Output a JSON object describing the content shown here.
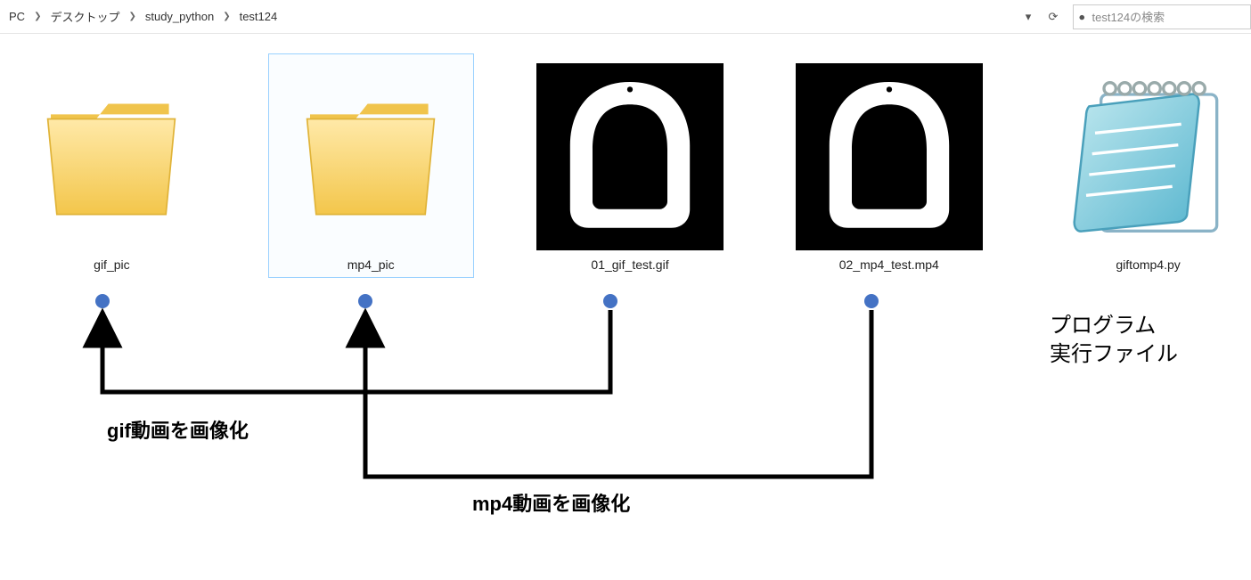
{
  "breadcrumb": {
    "parts": [
      "PC",
      "デスクトップ",
      "study_python",
      "test124"
    ]
  },
  "search": {
    "placeholder": "test124の検索"
  },
  "items": [
    {
      "label": "gif_pic",
      "selected": false,
      "kind": "folder"
    },
    {
      "label": "mp4_pic",
      "selected": true,
      "kind": "folder"
    },
    {
      "label": "01_gif_test.gif",
      "selected": false,
      "kind": "thumb"
    },
    {
      "label": "02_mp4_test.mp4",
      "selected": false,
      "kind": "thumb"
    },
    {
      "label": "giftomp4.py",
      "selected": false,
      "kind": "notepad"
    }
  ],
  "annotations": {
    "gif": "gif動画を画像化",
    "mp4": "mp4動画を画像化",
    "prog1": "プログラム",
    "prog2": "実行ファイル"
  }
}
